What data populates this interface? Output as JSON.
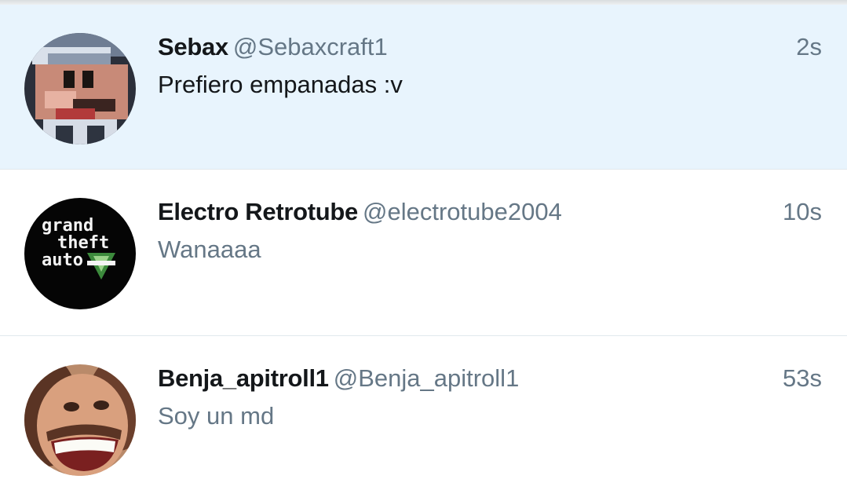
{
  "tweets": [
    {
      "name": "Sebax",
      "handle": "@Sebaxcraft1",
      "time": "2s",
      "text": "Prefiero empanadas :v",
      "avatar_icon": "pixel-mario-avatar",
      "highlighted": true
    },
    {
      "name": "Electro Retrotube",
      "handle": "@electrotube2004",
      "time": "10s",
      "text": "Wanaaaa",
      "avatar_icon": "gta-v-logo-avatar",
      "avatar_logo_text": [
        "grand",
        "theft",
        "auto"
      ],
      "highlighted": false
    },
    {
      "name": "Benja_apitroll1",
      "handle": "@Benja_apitroll1",
      "time": "53s",
      "text": "Soy un md",
      "avatar_icon": "smiling-face-avatar",
      "highlighted": false
    }
  ],
  "colors": {
    "highlight_bg": "#e8f4fd",
    "name": "#14171a",
    "secondary": "#657786",
    "divider": "#e1e8ed"
  }
}
